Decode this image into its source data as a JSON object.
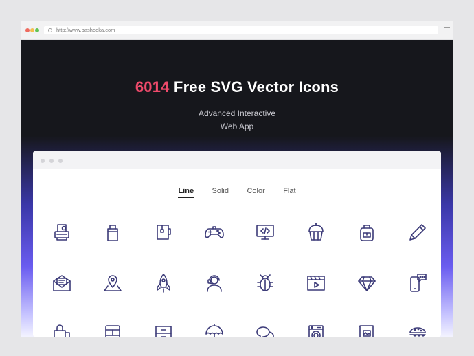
{
  "browser": {
    "url": "http://www.bashooka.com"
  },
  "hero": {
    "count": "6014",
    "title_rest": " Free SVG Vector Icons",
    "subtitle_line1": "Advanced Interactive",
    "subtitle_line2": "Web App"
  },
  "tabs": [
    {
      "label": "Line",
      "active": true
    },
    {
      "label": "Solid",
      "active": false
    },
    {
      "label": "Color",
      "active": false
    },
    {
      "label": "Flat",
      "active": false
    }
  ],
  "icons": {
    "row1": [
      "printer-icon",
      "shopping-bag-icon",
      "tea-mug-icon",
      "gamepad-icon",
      "code-monitor-icon",
      "cupcake-basket-icon",
      "backpack-icon",
      "pencil-icon"
    ],
    "row2": [
      "mail-letter-icon",
      "map-pin-icon",
      "rocket-icon",
      "support-agent-icon",
      "bug-icon",
      "video-player-icon",
      "diamond-icon",
      "mobile-chat-icon"
    ],
    "row3": [
      "shopping-bags-icon",
      "bus-icon",
      "drawer-cabinet-icon",
      "umbrella-icon",
      "chat-bubbles-icon",
      "washing-machine-icon",
      "image-book-icon",
      "burger-icon"
    ]
  },
  "colors": {
    "accent_number": "#ef4a6b",
    "icon_stroke": "#3b3a78",
    "hero_background": "#16171c",
    "gradient_purple": "#6a5cf0"
  }
}
